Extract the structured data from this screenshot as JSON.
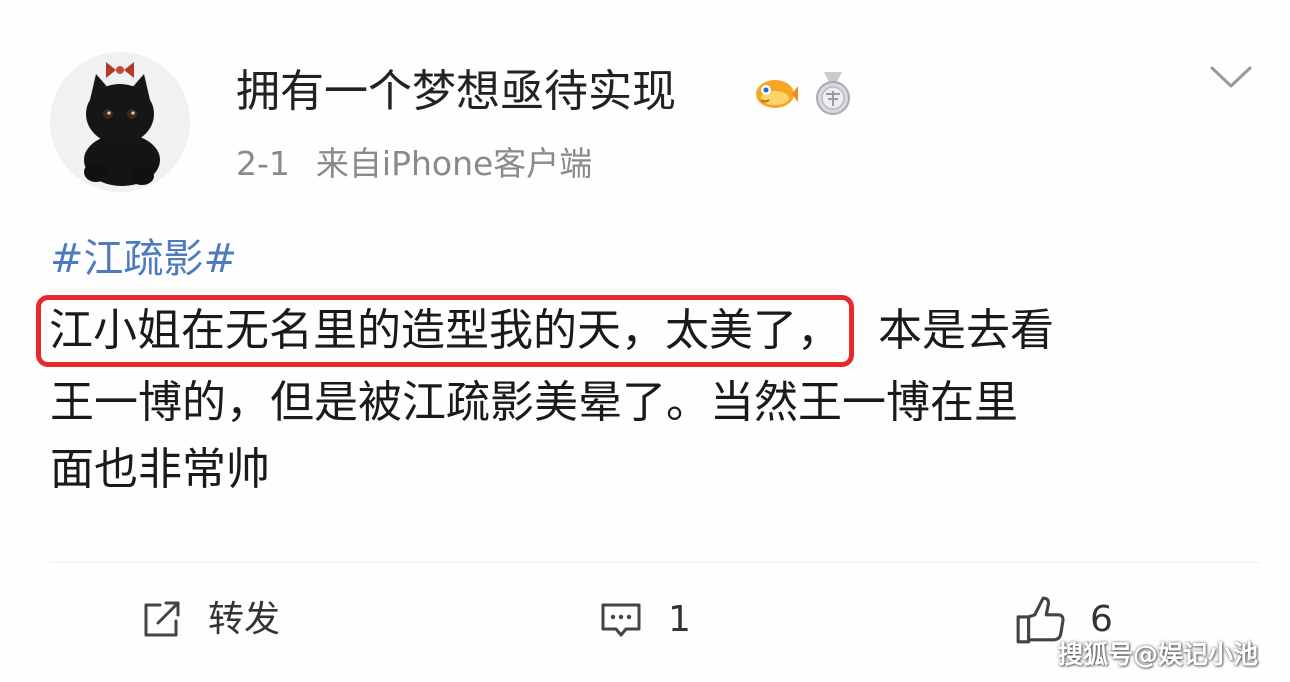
{
  "post": {
    "author": {
      "name": "拥有一个梦想亟待实现",
      "avatar": "black-kitten-with-red-bow",
      "badges": [
        "fish-emoji-icon",
        "medal-icon"
      ]
    },
    "meta": {
      "date": "2-1",
      "source": "来自iPhone客户端"
    },
    "hashtag": "#江疏影#",
    "lines": {
      "highlighted": "江小姐在无名里的造型我的天，太美了，",
      "line1_rest": "本是去看",
      "line2": "王一博的，但是被江疏影美晕了。当然王一博在里",
      "line3": "面也非常帅"
    },
    "highlight_color": "#e8272e",
    "hashtag_color": "#4c7bc0"
  },
  "actions": {
    "repost": {
      "label": "转发",
      "icon": "share-icon"
    },
    "comment": {
      "count": "1",
      "icon": "comment-icon"
    },
    "like": {
      "count": "6",
      "icon": "thumbs-up-icon"
    }
  },
  "watermark": "搜狐号@娱记小池"
}
